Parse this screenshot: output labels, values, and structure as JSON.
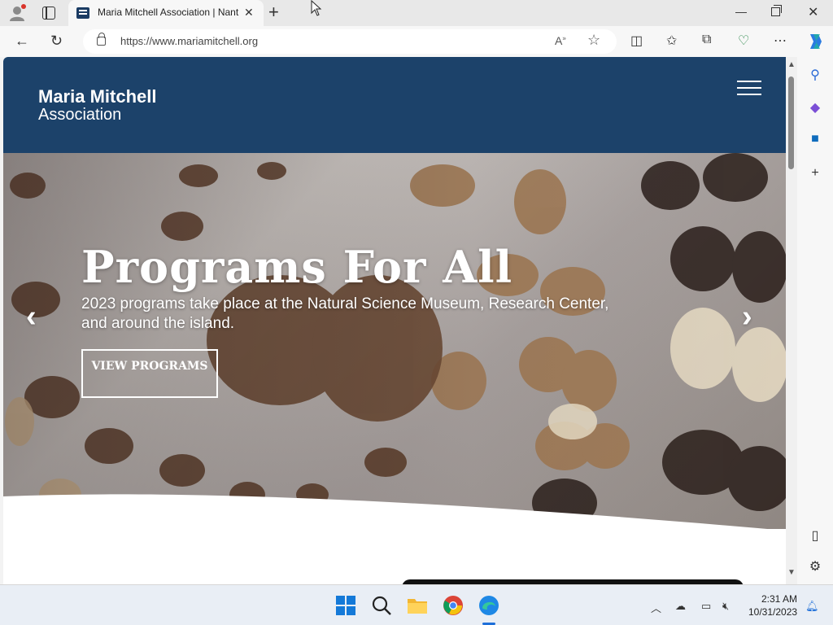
{
  "browser": {
    "tab_title": "Maria Mitchell Association | Nant",
    "url": "https://www.mariamitchell.org",
    "new_tab_symbol": "+",
    "close_tab_symbol": "✕"
  },
  "site": {
    "logo_line1": "Maria Mitchell",
    "logo_line2": "Association"
  },
  "hero": {
    "title": "Programs For All",
    "subtitle": "2023 programs take place at the Natural Science Museum, Research Center, and around the island.",
    "button_label": "VIEW PROGRAMS",
    "prev_arrow": "‹",
    "next_arrow": "›"
  },
  "taskbar": {
    "time": "2:31 AM",
    "date": "10/31/2023"
  },
  "colors": {
    "header_bg": "#1c426a",
    "hero_text": "#ffffff"
  }
}
